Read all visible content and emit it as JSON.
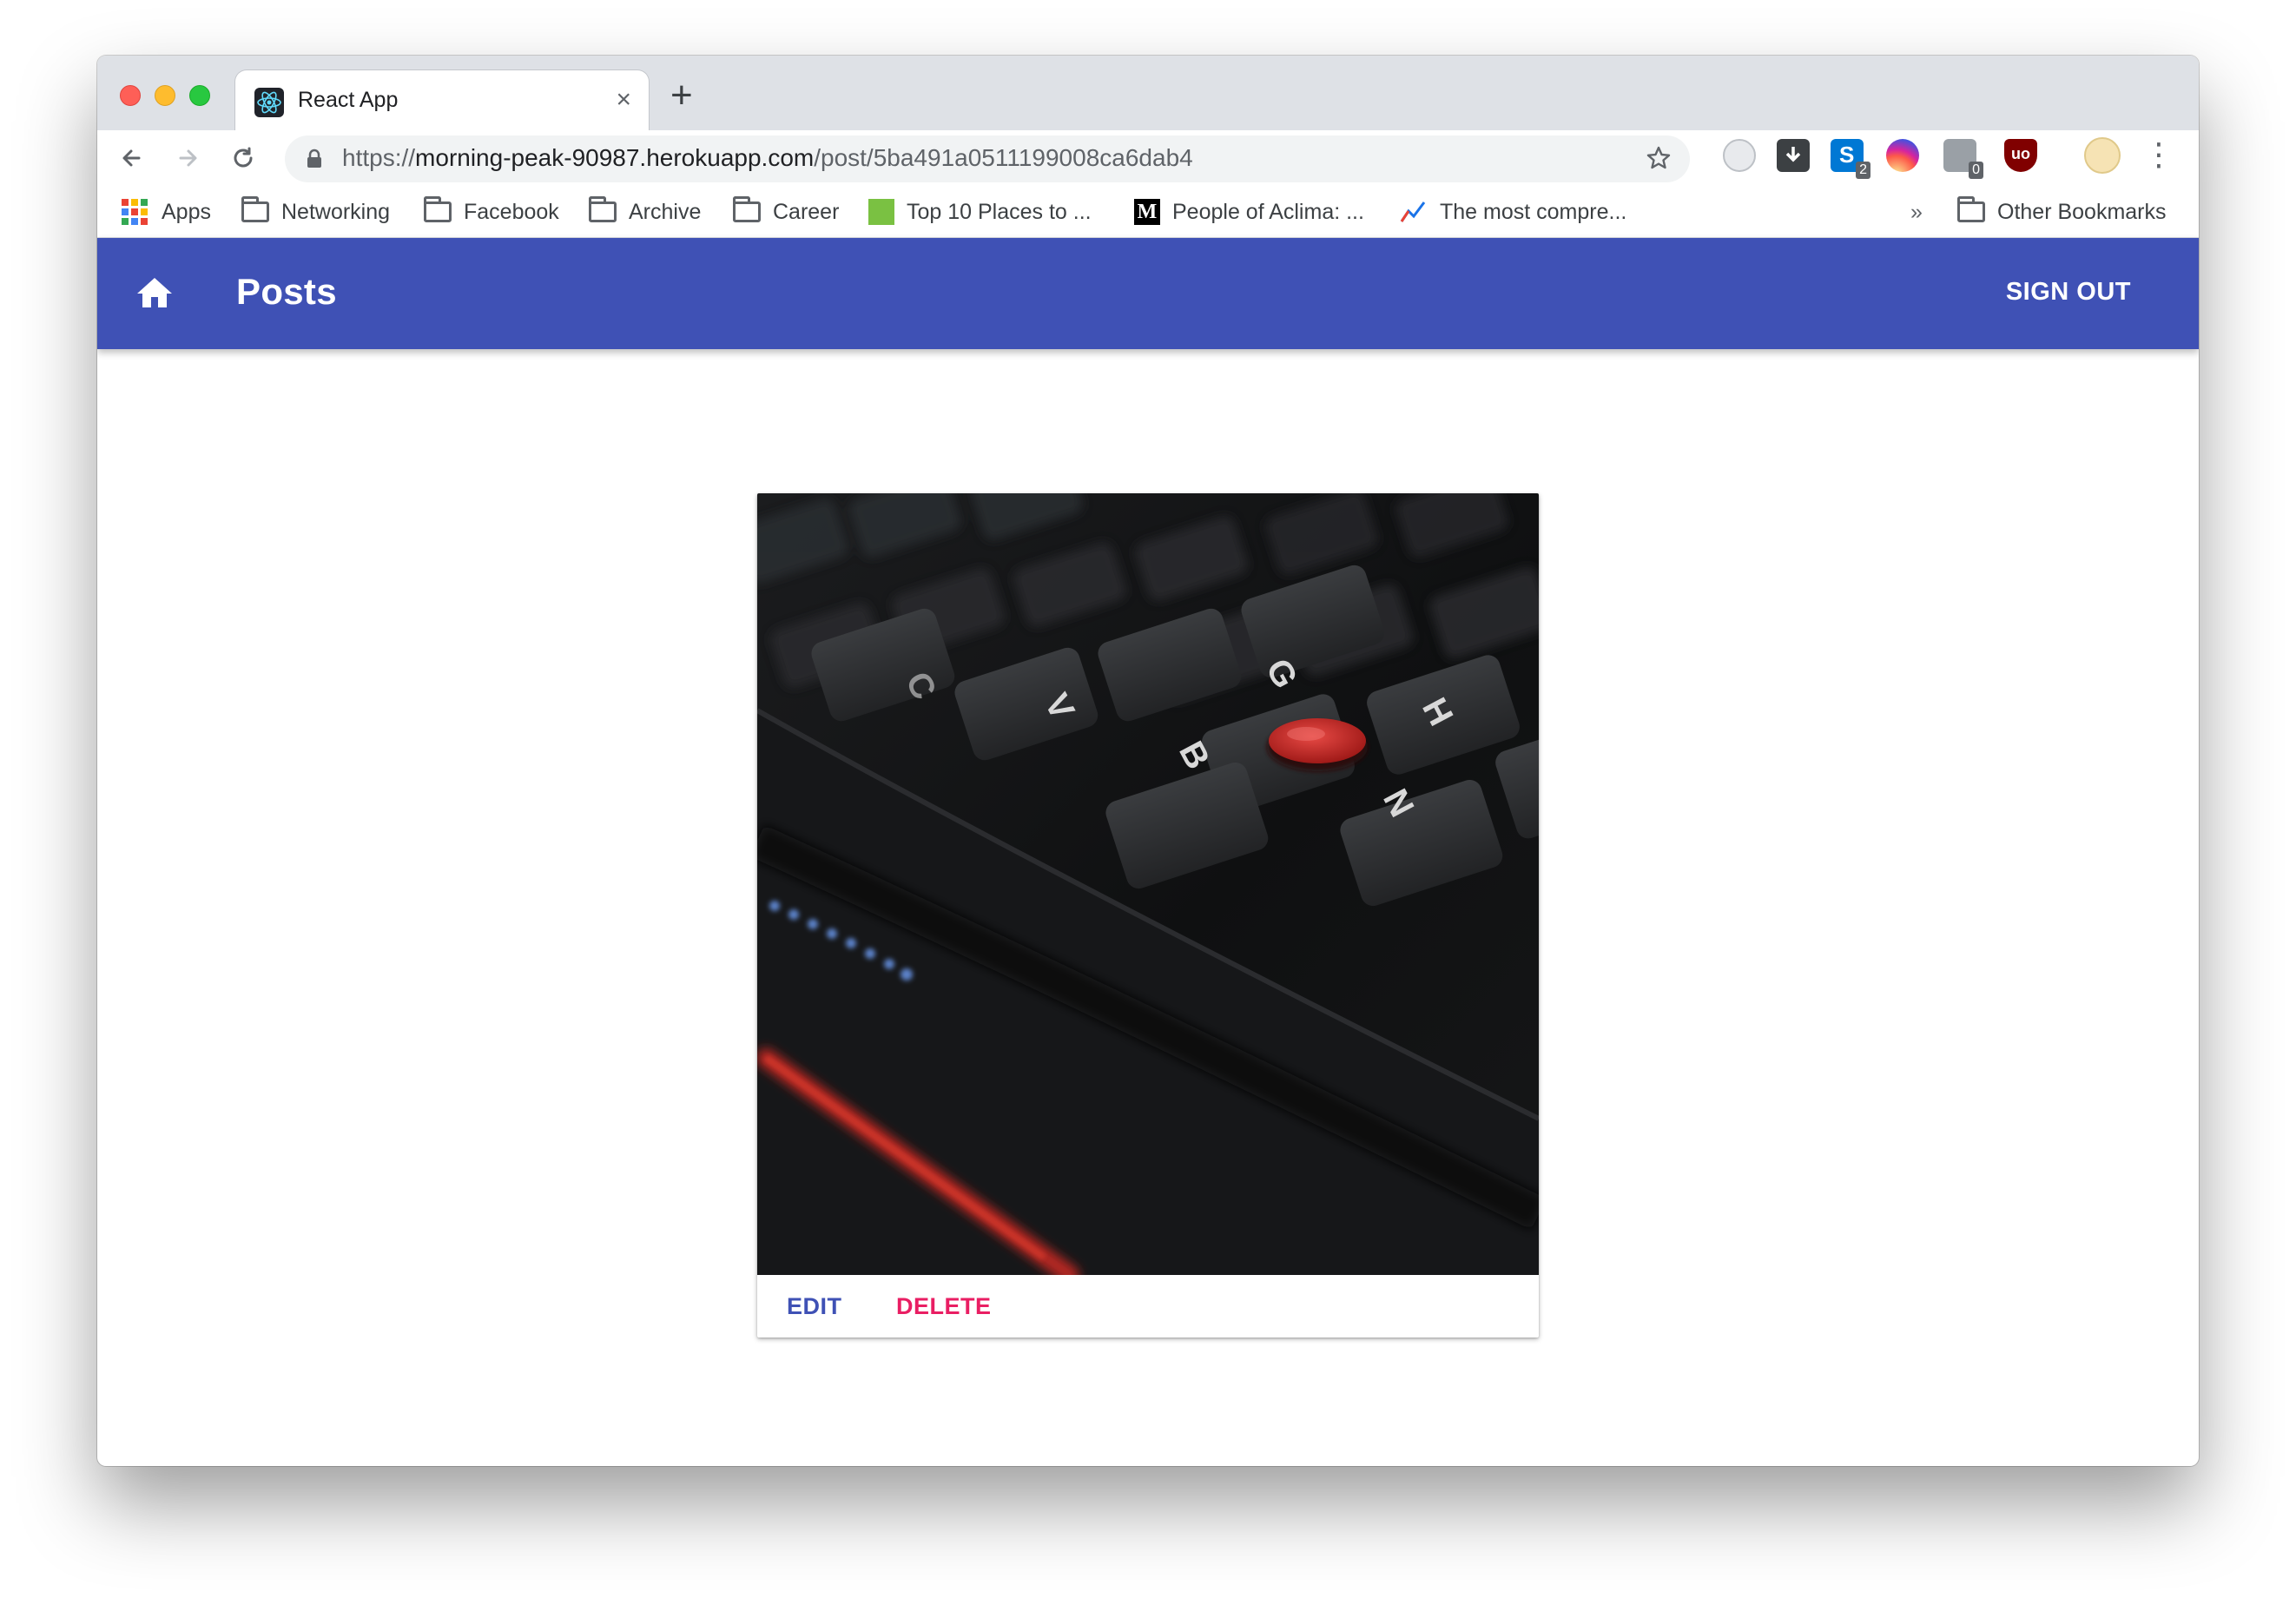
{
  "browser": {
    "tab": {
      "title": "React App",
      "close": "×"
    },
    "new_tab": "+",
    "url": {
      "scheme": "https://",
      "host": "morning-peak-90987.herokuapp.com",
      "path": "/post/5ba491a0511199008ca6dab4"
    },
    "extensions": [
      {
        "icon": "screenshot-extension-icon"
      },
      {
        "icon": "download-extension-icon"
      },
      {
        "icon": "skype-extension-icon",
        "badge": "2"
      },
      {
        "icon": "instagram-extension-icon"
      },
      {
        "icon": "puzzle-extension-icon",
        "badge": "0"
      },
      {
        "icon": "ublock-extension-icon"
      },
      {
        "icon": "profile-avatar-icon"
      }
    ],
    "bookmarks": [
      {
        "label": "Apps",
        "icon": "apps-grid-icon"
      },
      {
        "label": "Networking",
        "icon": "folder-icon"
      },
      {
        "label": "Facebook",
        "icon": "folder-icon"
      },
      {
        "label": "Archive",
        "icon": "folder-icon"
      },
      {
        "label": "Career",
        "icon": "folder-icon"
      },
      {
        "label": "Top 10 Places to ...",
        "icon": "houzz-icon"
      },
      {
        "label": "People of Aclima: ...",
        "icon": "medium-icon"
      },
      {
        "label": "The most compre...",
        "icon": "trend-icon"
      }
    ],
    "bookmarks_overflow": "»",
    "other_bookmarks": "Other Bookmarks"
  },
  "app": {
    "title": "Posts",
    "sign_out": "SIGN OUT",
    "accent": "#3f51b5",
    "secondary": "#e91e63"
  },
  "post": {
    "image_subject": "keyboard-photo",
    "keys": [
      "C",
      "V",
      "B",
      "G",
      "H",
      "N"
    ],
    "actions": {
      "edit": "EDIT",
      "delete": "DELETE"
    }
  }
}
